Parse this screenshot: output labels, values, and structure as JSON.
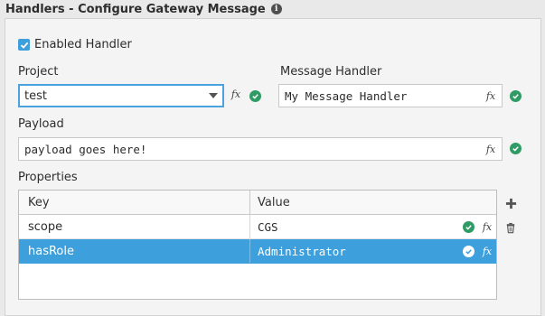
{
  "header": {
    "title": "Handlers - Configure Gateway Message",
    "info_icon": "info-circle-icon"
  },
  "enabled": {
    "label": "Enabled Handler",
    "checked": true
  },
  "project": {
    "label": "Project",
    "value": "test"
  },
  "message_handler": {
    "label": "Message Handler",
    "value": "My Message Handler"
  },
  "payload": {
    "label": "Payload",
    "value": "payload goes here!"
  },
  "expression_label": "fx",
  "properties": {
    "label": "Properties",
    "columns": [
      "Key",
      "Value"
    ],
    "rows": [
      {
        "key": "scope",
        "value": "CGS",
        "selected": false
      },
      {
        "key": "hasRole",
        "value": "Administrator",
        "selected": true
      }
    ]
  },
  "colors": {
    "accent": "#3d9fdb",
    "valid": "#2f9b65"
  }
}
